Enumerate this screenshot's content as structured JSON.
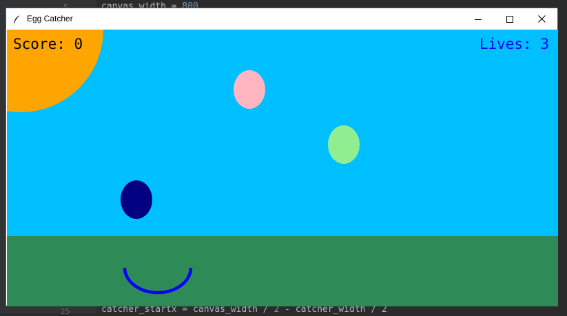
{
  "window": {
    "title": "Egg Catcher"
  },
  "editor_background": {
    "lines": [
      {
        "no": "5",
        "text_before": "canvas_width = ",
        "num": "800",
        "text_after": ""
      },
      {
        "no": "25",
        "text_before": "catcher_startx = canvas_width / ",
        "num": "2",
        "text_after": " - catcher_width / 2"
      }
    ]
  },
  "hud": {
    "score_label": "Score: 0",
    "lives_label": "Lives: 3"
  },
  "game": {
    "score": 0,
    "lives": 3,
    "eggs": [
      {
        "name": "egg-pink",
        "color": "#ffb6c1"
      },
      {
        "name": "egg-light-green",
        "color": "#90ee90"
      },
      {
        "name": "egg-navy",
        "color": "#000080"
      }
    ]
  },
  "colors": {
    "sky": "#00bfff",
    "ground": "#2e8b57",
    "sun": "#ffa500",
    "catcher": "#0000ff",
    "lives_text": "#0000ff",
    "score_text": "#000000"
  },
  "icons": {
    "app": "feather-icon",
    "minimize": "minimize-icon",
    "maximize": "maximize-icon",
    "close": "close-icon"
  }
}
